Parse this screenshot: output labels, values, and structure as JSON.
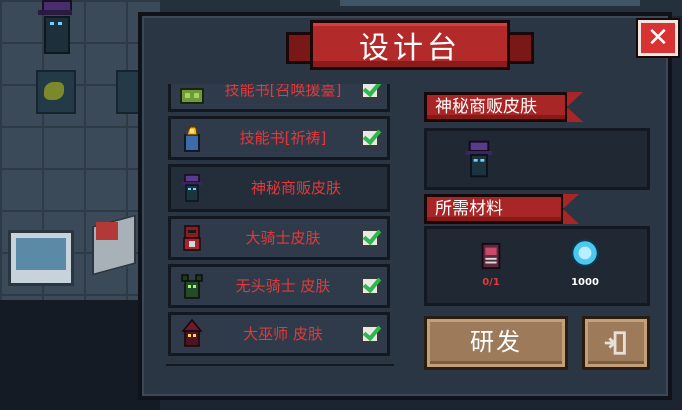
{
  "title": "设计台",
  "close_button": "✕",
  "colors": {
    "accent_red": "#b32a2a",
    "label_red": "#e03a3a",
    "check_green": "#2fb84a",
    "panel_bg": "#2a3644",
    "button_brown": "#9c7a5a",
    "gem_cyan": "#4ec8f0"
  },
  "recipes": [
    {
      "label": "技能书[召唤援臺]",
      "icon": "skill-book-summon-icon",
      "checked": true,
      "selected": false
    },
    {
      "label": "技能书[祈祷]",
      "icon": "skill-book-prayer-icon",
      "checked": true,
      "selected": false
    },
    {
      "label": "神秘商贩皮肤",
      "icon": "mysterious-merchant-skin-icon",
      "checked": false,
      "selected": true
    },
    {
      "label": "大骑士皮肤",
      "icon": "grand-knight-skin-icon",
      "checked": true,
      "selected": false
    },
    {
      "label": "无头骑士 皮肤",
      "icon": "headless-knight-skin-icon",
      "checked": true,
      "selected": false
    },
    {
      "label": "大巫师 皮肤",
      "icon": "grand-wizard-skin-icon",
      "checked": true,
      "selected": false
    }
  ],
  "detail": {
    "item_title": "神秘商贩皮肤",
    "materials_title": "所需材料",
    "materials": [
      {
        "icon": "material-card-icon",
        "count": "0/1",
        "count_color": "#e03a3a"
      },
      {
        "icon": "gem-currency-icon",
        "count": "1000",
        "count_color": "#ffffff"
      }
    ]
  },
  "research_button": "研发",
  "exit_button_icon": "exit-door-icon"
}
